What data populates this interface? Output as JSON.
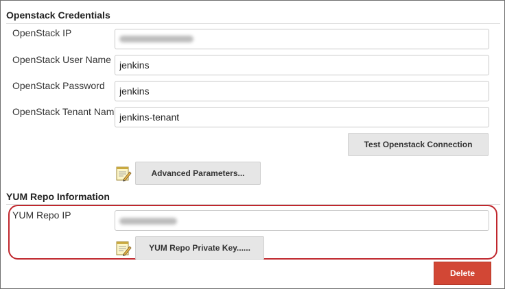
{
  "openstack": {
    "header": "Openstack Credentials",
    "ip_label": "OpenStack IP",
    "user_label": "OpenStack User Name",
    "user_value": "jenkins",
    "password_label": "OpenStack Password",
    "password_value": "jenkins",
    "tenant_label": "OpenStack Tenant Name",
    "tenant_value": "jenkins-tenant",
    "test_button": "Test Openstack Connection",
    "advanced_button": "Advanced Parameters..."
  },
  "yum": {
    "header": "YUM Repo Information",
    "ip_label": "YUM Repo IP",
    "private_key_button": "YUM Repo Private Key......"
  },
  "actions": {
    "delete_button": "Delete"
  },
  "colors": {
    "highlight": "#c0272d",
    "delete": "#d24735"
  },
  "icons": {
    "notepad": "notepad-edit-icon"
  }
}
